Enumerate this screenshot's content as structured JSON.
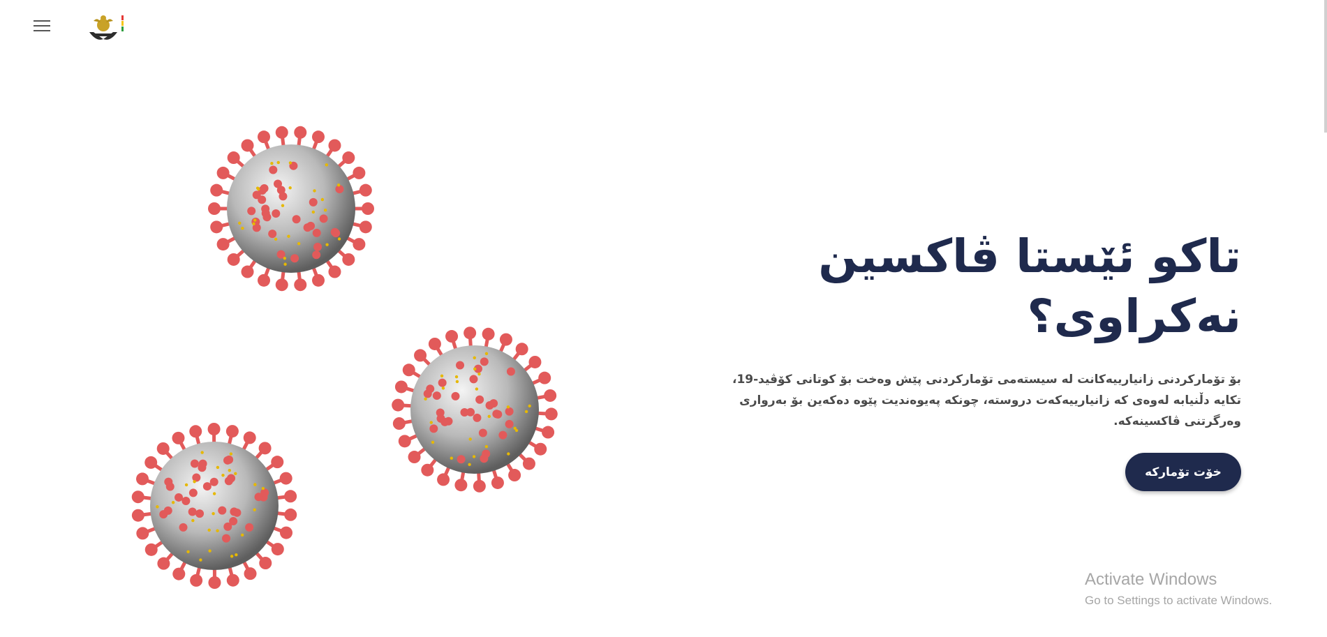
{
  "header": {
    "menu_icon": "hamburger-menu-icon",
    "logo_icon": "kurdistan-emblem-logo"
  },
  "hero": {
    "title": "تاکو ئێستا ڤاکسین نەکراوی؟",
    "description": "بۆ تۆمارکردنی زانیارییەکانت لە سیستەمی تۆمارکردنی پێش وەخت بۆ کوتانی کۆڤید-19، تکایە دڵنیابە لەوەی کە زانیارییەکەت دروستە، چونکە پەیوەندیت پێوە دەکەین بۆ بەرواری وەرگرتنی ڤاکسینەکە.",
    "cta_label": "خۆت تۆمارکە"
  },
  "colors": {
    "primary": "#1f2a4d",
    "virus_spike": "#e25a5a",
    "virus_body": "#b8b8b8"
  },
  "watermark": {
    "title": "Activate Windows",
    "subtitle": "Go to Settings to activate Windows."
  }
}
